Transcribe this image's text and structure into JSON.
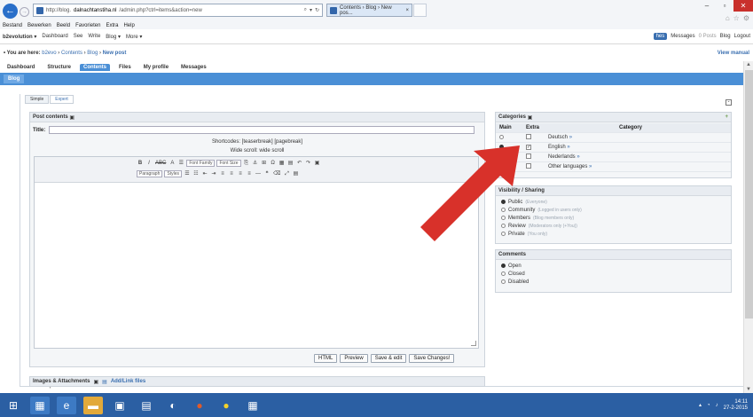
{
  "browser": {
    "address_prefix": "http://blog.",
    "address_highlight": "dalnachtanstiha.nl",
    "address_rest": "/admin.php?ctrl=items&action=new",
    "tab_title": "Contents › Blog › New pos...",
    "menu": [
      "Bestand",
      "Bewerken",
      "Beeld",
      "Favorieten",
      "Extra",
      "Help"
    ]
  },
  "adminbar": {
    "items": [
      "b2evolution ▾",
      "Dashboard",
      "See",
      "Write",
      "Blog ▾",
      "More ▾"
    ],
    "user": "hes",
    "messages": "Messages",
    "posts_badge": "0 Posts",
    "blog": "Blog",
    "logout": "Logout"
  },
  "breadcrumb": {
    "label": "• You are here:",
    "items": [
      "b2evo",
      "Contents",
      "Blog"
    ],
    "current": "New post",
    "view_manual": "View manual"
  },
  "mainnav": [
    "Dashboard",
    "Structure",
    "Contents",
    "Files",
    "My profile",
    "Messages"
  ],
  "subnav_tab": "Blog",
  "mode_tabs": [
    "Simple",
    "Expert"
  ],
  "post": {
    "panel_title": "Post contents",
    "title_label": "Title:",
    "shortcodes": "Shortcodes: [teaserbreak] [pagebreak]",
    "wide_scroll": "Wide scroll: wide scroll",
    "toolbar_row1": [
      "B",
      "I",
      "ABC",
      "A",
      "☰",
      "Font Family",
      "Font Size",
      "⎘",
      "⚓",
      "⊞",
      "Ω",
      "▦",
      "▤",
      "↶",
      "↷",
      "▣"
    ],
    "toolbar_row2": [
      "Paragraph",
      "Styles",
      "☰",
      "☷",
      "⇤",
      "⇥",
      "≡",
      "≡",
      "≡",
      "≡",
      "—",
      "❝",
      "⌫",
      "⤢",
      "▤"
    ],
    "path": "Path: p",
    "buttons": [
      "HTML",
      "Preview",
      "Save & edit",
      "Save Changes!"
    ]
  },
  "categories": {
    "title": "Categories",
    "headers": [
      "Main",
      "Extra",
      "Category"
    ],
    "rows": [
      {
        "name": "Deutsch",
        "main": false,
        "extra": false
      },
      {
        "name": "English",
        "main": true,
        "extra": true
      },
      {
        "name": "Nederlands",
        "main": false,
        "extra": false
      },
      {
        "name": "Other languages",
        "main": false,
        "extra": false
      }
    ]
  },
  "visibility": {
    "title": "Visibility / Sharing",
    "options": [
      {
        "label": "Public",
        "note": "(Everyone)",
        "on": true
      },
      {
        "label": "Community",
        "note": "(Logged in users only)",
        "on": false
      },
      {
        "label": "Members",
        "note": "(Blog members only)",
        "on": false
      },
      {
        "label": "Review",
        "note": "(Moderators only (+You))",
        "on": false
      },
      {
        "label": "Private",
        "note": "(You only)",
        "on": false
      }
    ]
  },
  "comments": {
    "title": "Comments",
    "options": [
      {
        "label": "Open",
        "on": true
      },
      {
        "label": "Closed",
        "on": false
      },
      {
        "label": "Disabled",
        "on": false
      }
    ]
  },
  "images": {
    "title": "Images & Attachments",
    "add": "Add/Link files"
  },
  "taskbar": {
    "time": "14:11",
    "date": "27-2-2015"
  },
  "colors": {
    "arrow": "#d8312a",
    "nav_blue": "#4a8fd6",
    "taskbar": "#2b5fa3"
  }
}
